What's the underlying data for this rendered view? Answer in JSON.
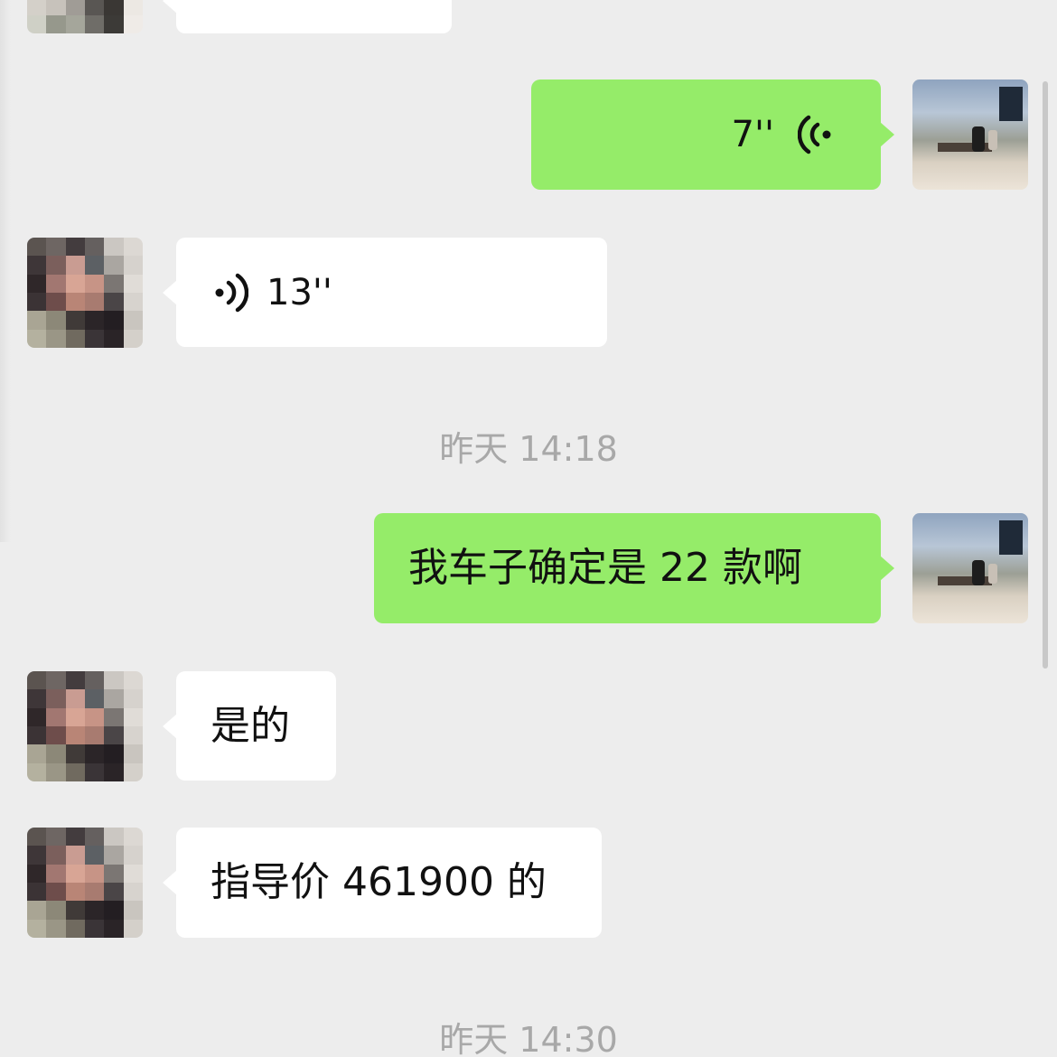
{
  "messages": {
    "voice_out": {
      "duration": "7''"
    },
    "voice_in": {
      "duration": "13''"
    },
    "time_1": "昨天 14:18",
    "text_out_1": "我车子确定是 22 款啊",
    "text_in_1": "是的",
    "text_in_2": "指导价 461900 的",
    "time_2": "昨天 14:30"
  },
  "icons": {
    "voice_out": "voice-wave-icon",
    "voice_in": "voice-wave-icon"
  },
  "colors": {
    "background": "#ededed",
    "bubble_out": "#95ec69",
    "bubble_in": "#ffffff",
    "timestamp": "#a8a8a8"
  }
}
